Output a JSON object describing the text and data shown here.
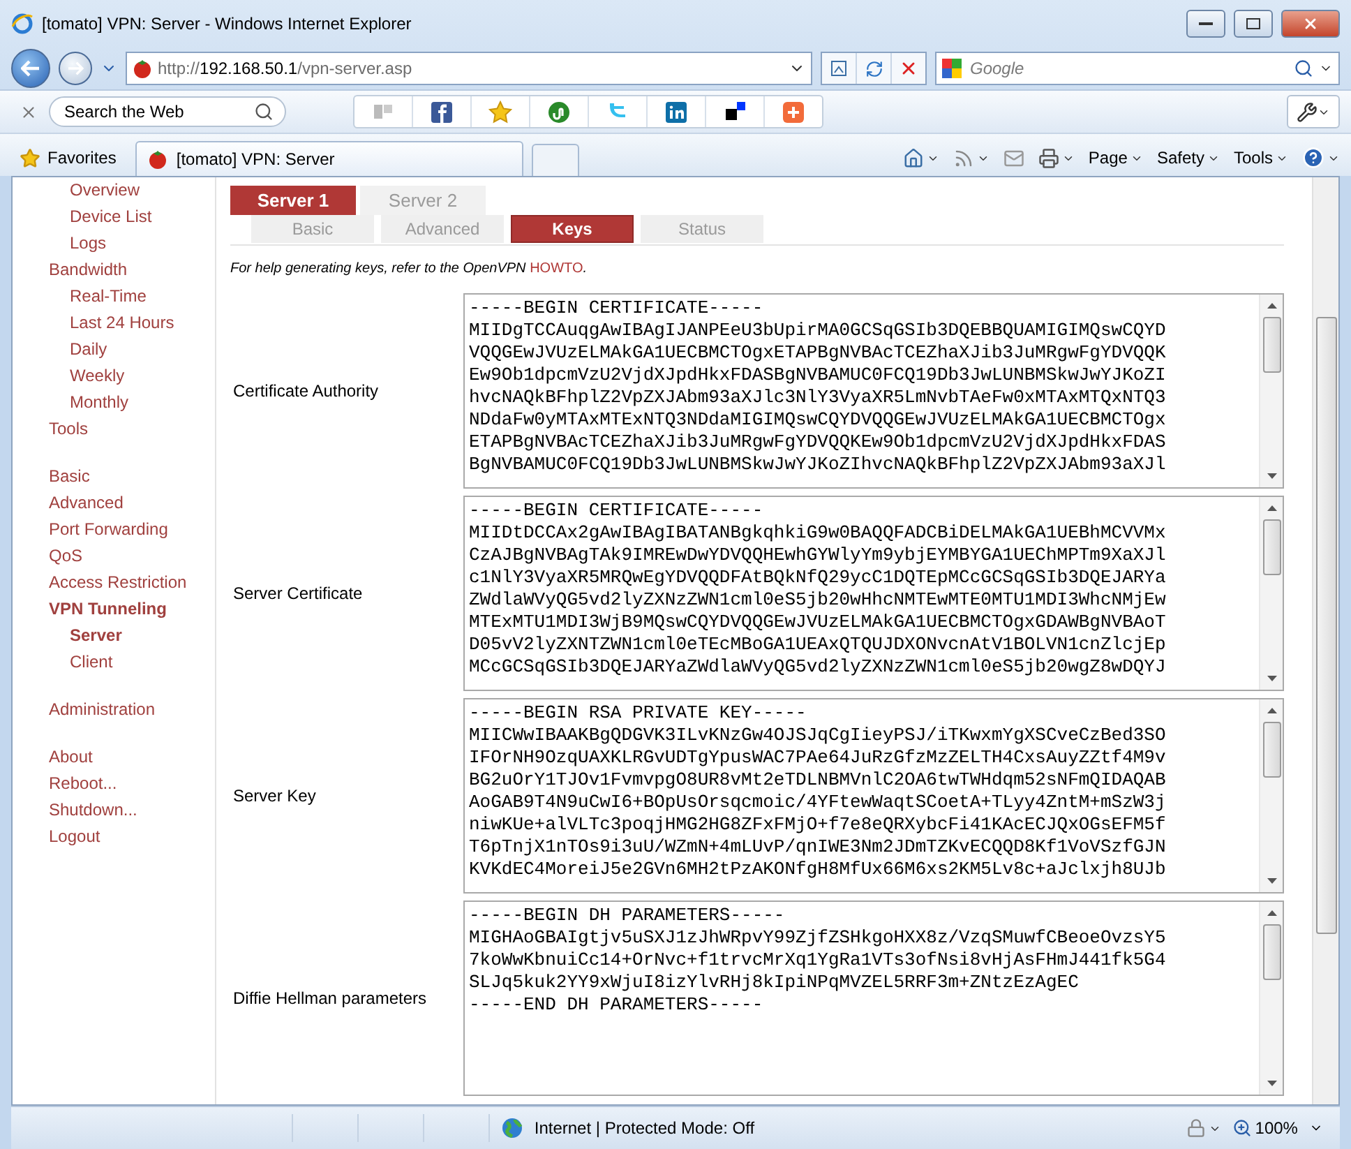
{
  "window": {
    "title": "[tomato] VPN: Server - Windows Internet Explorer"
  },
  "address_bar": {
    "url_scheme": "http://",
    "url_host": "192.168.50.1",
    "url_path": "/vpn-server.asp"
  },
  "search_box": {
    "placeholder": "Google"
  },
  "toolbar": {
    "search_placeholder": "Search the Web"
  },
  "favorites_bar": {
    "favorites": "Favorites",
    "tab_title": "[tomato] VPN: Server"
  },
  "command_bar": [
    {
      "label": "Page"
    },
    {
      "label": "Safety"
    },
    {
      "label": "Tools"
    }
  ],
  "sidebar": {
    "groups": [
      [
        {
          "children": [
            {
              "label": "Overview",
              "selected": false
            },
            {
              "label": "Device List",
              "selected": false
            },
            {
              "label": "Logs",
              "selected": false
            }
          ]
        },
        {
          "label": "Bandwidth",
          "selected": false,
          "children": [
            {
              "label": "Real-Time",
              "selected": false
            },
            {
              "label": "Last 24 Hours",
              "selected": false
            },
            {
              "label": "Daily",
              "selected": false
            },
            {
              "label": "Weekly",
              "selected": false
            },
            {
              "label": "Monthly",
              "selected": false
            }
          ]
        },
        {
          "label": "Tools",
          "selected": false
        }
      ],
      [
        {
          "label": "Basic",
          "selected": false
        },
        {
          "label": "Advanced",
          "selected": false
        },
        {
          "label": "Port Forwarding",
          "selected": false
        },
        {
          "label": "QoS",
          "selected": false
        },
        {
          "label": "Access Restriction",
          "selected": false
        },
        {
          "label": "VPN Tunneling",
          "selected": true,
          "children": [
            {
              "label": "Server",
              "selected": true
            },
            {
              "label": "Client",
              "selected": false
            }
          ]
        }
      ],
      [
        {
          "label": "Administration",
          "selected": false
        }
      ],
      [
        {
          "label": "About",
          "selected": false
        },
        {
          "label": "Reboot...",
          "selected": false
        },
        {
          "label": "Shutdown...",
          "selected": false
        },
        {
          "label": "Logout",
          "selected": false
        }
      ]
    ]
  },
  "server_tabs": [
    {
      "label": "Server 1",
      "selected": true
    },
    {
      "label": "Server 2",
      "selected": false
    }
  ],
  "sub_tabs": [
    {
      "label": "Basic",
      "selected": false
    },
    {
      "label": "Advanced",
      "selected": false
    },
    {
      "label": "Keys",
      "selected": true
    },
    {
      "label": "Status",
      "selected": false
    }
  ],
  "help": {
    "text": "For help generating keys, refer to the OpenVPN",
    "link": "HOWTO",
    "suffix": "."
  },
  "key_fields": [
    {
      "label": "Certificate Authority",
      "lines": [
        "-----BEGIN CERTIFICATE-----",
        "MIIDgTCCAuqgAwIBAgIJANPEeU3bUpirMA0GCSqGSIb3DQEBBQUAMIGIMQswCQYD",
        "VQQGEwJVUzELMAkGA1UECBMCTOgxETAPBgNVBAcTCEZhaXJib3JuMRgwFgYDVQQK",
        "Ew9Ob1dpcmVzU2VjdXJpdHkxFDASBgNVBAMUC0FCQ19Db3JwLUNBMSkwJwYJKoZI",
        "hvcNAQkBFhplZ2VpZXJAbm93aXJlc3NlY3VyaXR5LmNvbTAeFw0xMTAxMTQxNTQ3",
        "NDdaFw0yMTAxMTExNTQ3NDdaMIGIMQswCQYDVQQGEwJVUzELMAkGA1UECBMCTOgx",
        "ETAPBgNVBAcTCEZhaXJib3JuMRgwFgYDVQQKEw9Ob1dpcmVzU2VjdXJpdHkxFDAS",
        "BgNVBAMUC0FCQ19Db3JwLUNBMSkwJwYJKoZIhvcNAQkBFhplZ2VpZXJAbm93aXJl"
      ]
    },
    {
      "label": "Server Certificate",
      "lines": [
        "-----BEGIN CERTIFICATE-----",
        "MIIDtDCCAx2gAwIBAgIBATANBgkqhkiG9w0BAQQFADCBiDELMAkGA1UEBhMCVVMx",
        "CzAJBgNVBAgTAk9IMREwDwYDVQQHEwhGYWlyYm9ybjEYMBYGA1UEChMPTm9XaXJl",
        "c1NlY3VyaXR5MRQwEgYDVQQDFAtBQkNfQ29ycC1DQTEpMCcGCSqGSIb3DQEJARYa",
        "ZWdlaWVyQG5vd2lyZXNzZWN1cml0eS5jb20wHhcNMTEwMTE0MTU1MDI3WhcNMjEw",
        "MTExMTU1MDI3WjB9MQswCQYDVQQGEwJVUzELMAkGA1UECBMCTOgxGDAWBgNVBAoT",
        "D05vV2lyZXNTZWN1cml0eTEcMBoGA1UEAxQTQUJDXONvcnAtV1BOLVN1cnZlcjEp",
        "MCcGCSqGSIb3DQEJARYaZWdlaWVyQG5vd2lyZXNzZWN1cml0eS5jb20wgZ8wDQYJ"
      ]
    },
    {
      "label": "Server Key",
      "lines": [
        "-----BEGIN RSA PRIVATE KEY-----",
        "MIICWwIBAAKBgQDGVK3ILvKNzGw4OJSJqCgIieyPSJ/iTKwxmYgXSCveCzBed3SO",
        "IFOrNH9OzqUAXKLRGvUDTgYpusWAC7PAe64JuRzGfzMzZELTH4CxsAuyZZtf4M9v",
        "BG2uOrY1TJOv1FvmvpgO8UR8vMt2eTDLNBMVnlC2OA6twTWHdqm52sNFmQIDAQAB",
        "AoGAB9T4N9uCwI6+BOpUsOrsqcmoic/4YFtewWaqtSCoetA+TLyy4ZntM+mSzW3j",
        "niwKUe+alVLTc3poqjHMG2HG8ZFxFMjO+f7e8eQRXybcFi41KAcECJQxOGsEFM5f",
        "T6pTnjX1nTOs9i3uU/WZmN+4mLUvP/qnIWE3Nm2JDmTZKvECQQD8Kf1VoVSzfGJN",
        "KVKdEC4MoreiJ5e2GVn6MH2tPzAKONfgH8MfUx66M6xs2KM5Lv8c+aJclxjh8UJb"
      ]
    },
    {
      "label": "Diffie Hellman parameters",
      "lines": [
        "-----BEGIN DH PARAMETERS-----",
        "MIGHAoGBAIgtjv5uSXJ1zJhWRpvY99ZjfZSHkgoHXX8z/VzqSMuwfCBeoeOvzsY5",
        "7koWwKbnuiCc14+OrNvc+f1trvcMrXq1YgRa1VTs3ofNsi8vHjAsFHmJ441fk5G4",
        "SLJq5kuk2YY9xWjuI8izYlvRHj8kIpiNPqMVZEL5RRF3m+ZNtzEzAgEC",
        "-----END DH PARAMETERS-----"
      ]
    }
  ],
  "status_bar": {
    "zone": "Internet | Protected Mode: Off",
    "zoom": "100%"
  }
}
